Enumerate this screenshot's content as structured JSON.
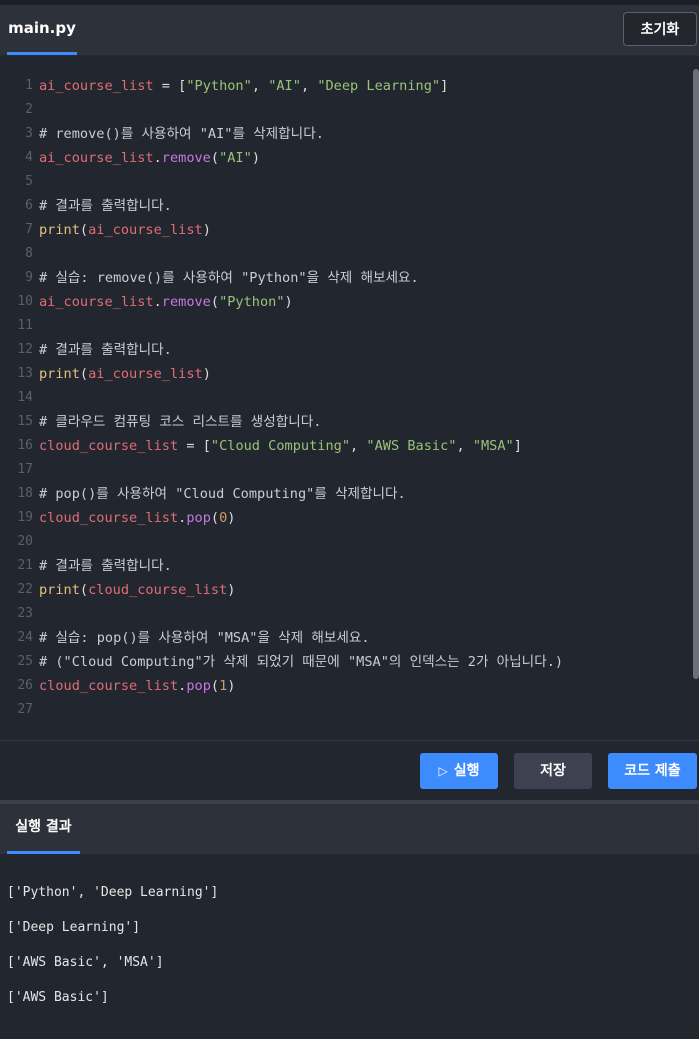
{
  "header": {
    "tab_label": "main.py",
    "reset_label": "초기화"
  },
  "editor": {
    "lines": [
      {
        "n": "1",
        "segs": [
          [
            "kvar",
            "ai_course_list"
          ],
          [
            "kpunc",
            " = ["
          ],
          [
            "kstr",
            "\"Python\""
          ],
          [
            "kpunc",
            ", "
          ],
          [
            "kstr",
            "\"AI\""
          ],
          [
            "kpunc",
            ", "
          ],
          [
            "kstr",
            "\"Deep Learning\""
          ],
          [
            "kpunc",
            "]"
          ]
        ]
      },
      {
        "n": "2",
        "segs": []
      },
      {
        "n": "3",
        "segs": [
          [
            "kcom",
            "# remove()를 사용하여 \"AI\"를 삭제합니다."
          ]
        ]
      },
      {
        "n": "4",
        "segs": [
          [
            "kvar",
            "ai_course_list"
          ],
          [
            "kpunc",
            "."
          ],
          [
            "kmeth",
            "remove"
          ],
          [
            "kpunc",
            "("
          ],
          [
            "kstr",
            "\"AI\""
          ],
          [
            "kpunc",
            ")"
          ]
        ]
      },
      {
        "n": "5",
        "segs": []
      },
      {
        "n": "6",
        "segs": [
          [
            "kcom",
            "# 결과를 출력합니다."
          ]
        ]
      },
      {
        "n": "7",
        "segs": [
          [
            "kfn",
            "print"
          ],
          [
            "kpunc",
            "("
          ],
          [
            "kvar",
            "ai_course_list"
          ],
          [
            "kpunc",
            ")"
          ]
        ]
      },
      {
        "n": "8",
        "segs": []
      },
      {
        "n": "9",
        "segs": [
          [
            "kcom",
            "# 실습: remove()를 사용하여 \"Python\"을 삭제 해보세요."
          ]
        ]
      },
      {
        "n": "10",
        "segs": [
          [
            "kvar",
            "ai_course_list"
          ],
          [
            "kpunc",
            "."
          ],
          [
            "kmeth",
            "remove"
          ],
          [
            "kpunc",
            "("
          ],
          [
            "kstr",
            "\"Python\""
          ],
          [
            "kpunc",
            ")"
          ]
        ]
      },
      {
        "n": "11",
        "segs": []
      },
      {
        "n": "12",
        "segs": [
          [
            "kcom",
            "# 결과를 출력합니다."
          ]
        ]
      },
      {
        "n": "13",
        "segs": [
          [
            "kfn",
            "print"
          ],
          [
            "kpunc",
            "("
          ],
          [
            "kvar",
            "ai_course_list"
          ],
          [
            "kpunc",
            ")"
          ]
        ]
      },
      {
        "n": "14",
        "segs": []
      },
      {
        "n": "15",
        "segs": [
          [
            "kcom",
            "# 클라우드 컴퓨팅 코스 리스트를 생성합니다."
          ]
        ]
      },
      {
        "n": "16",
        "segs": [
          [
            "kvar",
            "cloud_course_list"
          ],
          [
            "kpunc",
            " = ["
          ],
          [
            "kstr",
            "\"Cloud Computing\""
          ],
          [
            "kpunc",
            ", "
          ],
          [
            "kstr",
            "\"AWS Basic\""
          ],
          [
            "kpunc",
            ", "
          ],
          [
            "kstr",
            "\"MSA\""
          ],
          [
            "kpunc",
            "]"
          ]
        ]
      },
      {
        "n": "17",
        "segs": []
      },
      {
        "n": "18",
        "segs": [
          [
            "kcom",
            "# pop()를 사용하여 \"Cloud Computing\"를 삭제합니다."
          ]
        ]
      },
      {
        "n": "19",
        "segs": [
          [
            "kvar",
            "cloud_course_list"
          ],
          [
            "kpunc",
            "."
          ],
          [
            "kmeth",
            "pop"
          ],
          [
            "kpunc",
            "("
          ],
          [
            "knum",
            "0"
          ],
          [
            "kpunc",
            ")"
          ]
        ]
      },
      {
        "n": "20",
        "segs": []
      },
      {
        "n": "21",
        "segs": [
          [
            "kcom",
            "# 결과를 출력합니다."
          ]
        ]
      },
      {
        "n": "22",
        "segs": [
          [
            "kfn",
            "print"
          ],
          [
            "kpunc",
            "("
          ],
          [
            "kvar",
            "cloud_course_list"
          ],
          [
            "kpunc",
            ")"
          ]
        ]
      },
      {
        "n": "23",
        "segs": []
      },
      {
        "n": "24",
        "segs": [
          [
            "kcom",
            "# 실습: pop()를 사용하여 \"MSA\"을 삭제 해보세요."
          ]
        ]
      },
      {
        "n": "25",
        "segs": [
          [
            "kcom",
            "# (\"Cloud Computing\"가 삭제 되었기 때문에 \"MSA\"의 인덱스는 2가 아닙니다.)"
          ]
        ]
      },
      {
        "n": "26",
        "segs": [
          [
            "kvar",
            "cloud_course_list"
          ],
          [
            "kpunc",
            "."
          ],
          [
            "kmeth",
            "pop"
          ],
          [
            "kpunc",
            "("
          ],
          [
            "knum",
            "1"
          ],
          [
            "kpunc",
            ")"
          ]
        ]
      },
      {
        "n": "27",
        "segs": []
      }
    ]
  },
  "actions": {
    "run_label": "실행",
    "save_label": "저장",
    "submit_label": "코드 제출"
  },
  "output": {
    "tab_label": "실행 결과",
    "lines": [
      "['Python', 'Deep Learning']",
      "['Deep Learning']",
      "['AWS Basic', 'MSA']",
      "['AWS Basic']"
    ]
  }
}
